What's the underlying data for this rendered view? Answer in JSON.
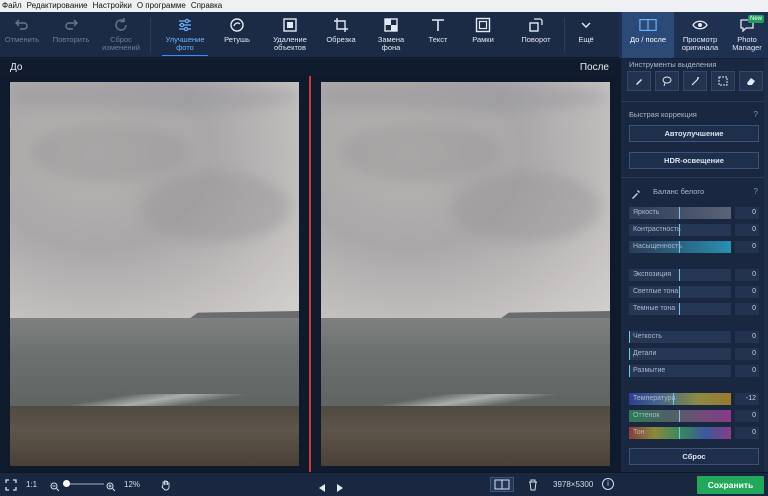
{
  "menu": [
    "Файл",
    "Редактирование",
    "Настройки",
    "О программе",
    "Справка"
  ],
  "toolbar": {
    "undo": "Отменить",
    "redo": "Повторить",
    "reset": "Сброс изменений",
    "enhance": "Улучшение фото",
    "retouch": "Ретушь",
    "remove": "Удаление объектов",
    "crop": "Обрезка",
    "bg": "Замена фона",
    "text": "Текст",
    "frames": "Рамки",
    "rotate": "Поворот",
    "more": "Ещё",
    "before_after": "До / после",
    "original": "Просмотр оригинала",
    "manager": "Photo Manager",
    "new_badge": "New"
  },
  "view": {
    "before": "До",
    "after": "После"
  },
  "panel": {
    "selection_tools": "Инструменты выделения",
    "quick_fix": "Быстрая коррекция",
    "auto": "Автоулучшение",
    "hdr": "HDR-освещение",
    "white_balance": "Баланс белого",
    "help": "?",
    "group1": [
      {
        "label": "Яркость",
        "value": "0"
      },
      {
        "label": "Контрастность",
        "value": "0"
      },
      {
        "label": "Насыщенность",
        "value": "0"
      }
    ],
    "group2": [
      {
        "label": "Экспозиция",
        "value": "0"
      },
      {
        "label": "Светлые тона",
        "value": "0"
      },
      {
        "label": "Темные тона",
        "value": "0"
      }
    ],
    "group3": [
      {
        "label": "Четкость",
        "value": "0"
      },
      {
        "label": "Детали",
        "value": "0"
      },
      {
        "label": "Размытие",
        "value": "0"
      }
    ],
    "group4": [
      {
        "label": "Температура",
        "value": "-12"
      },
      {
        "label": "Оттенок",
        "value": "0"
      },
      {
        "label": "Тон",
        "value": "0"
      }
    ],
    "reset": "Сброс"
  },
  "bottom": {
    "ratio": "1:1",
    "zoom": "12%",
    "dimensions": "3978×5300",
    "save": "Сохранить"
  },
  "colors": {
    "accent": "#3a8cff",
    "save": "#22a85a",
    "divider": "#d0393b"
  }
}
